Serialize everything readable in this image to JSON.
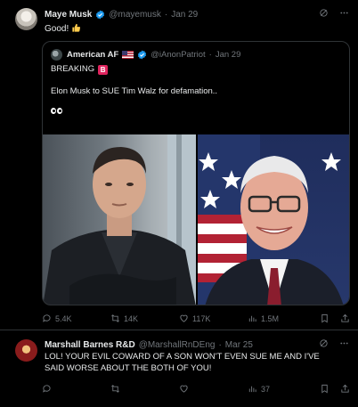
{
  "colors": {
    "background": "#000000",
    "text": "#e7e9ea",
    "muted": "#71767b",
    "border": "#2f3336",
    "verified": "#1d9bf0",
    "badge": "#e0245e"
  },
  "post1": {
    "author": "Maye Musk",
    "handle": "@mayemusk",
    "separator": "·",
    "date": "Jan 29",
    "text": "Good!",
    "emoji": "thumbs-up",
    "quote": {
      "author": "American AF",
      "flag": "us-flag",
      "handle": "@iAnonPatriot",
      "separator": "·",
      "date": "Jan 29",
      "line1": "BREAKING",
      "badge": "B",
      "line2": "Elon Musk to SUE Tim Walz for defamation..",
      "emoji": "eyes"
    },
    "actions": {
      "replies": "5.4K",
      "reposts": "14K",
      "likes": "117K",
      "views": "1.5M"
    }
  },
  "post2": {
    "author": "Marshall Barnes R&D",
    "handle": "@MarshallRnDEng",
    "separator": "·",
    "date": "Mar 25",
    "text": "LOL! YOUR EVIL COWARD OF A SON WON'T EVEN SUE ME AND I'VE SAID WORSE ABOUT THE BOTH OF YOU!",
    "actions": {
      "views": "37"
    }
  }
}
